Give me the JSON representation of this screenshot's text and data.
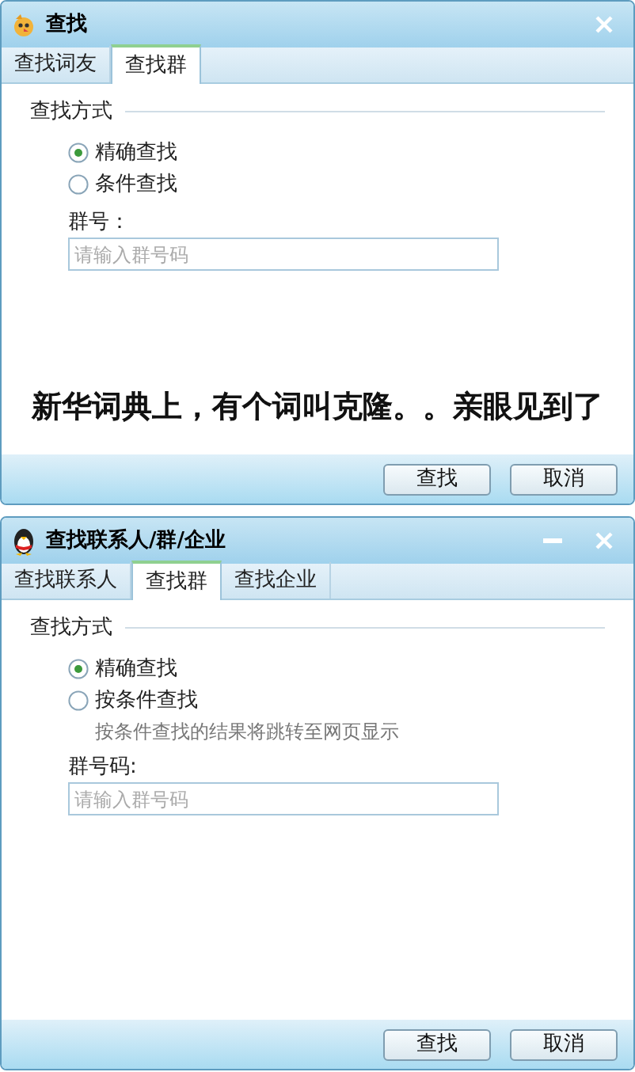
{
  "windows": [
    {
      "title": "查找",
      "kind": "classic",
      "tabs": [
        {
          "label": "查找词友",
          "selected": false
        },
        {
          "label": "查找群",
          "selected": true
        }
      ],
      "section": "查找方式",
      "options": [
        {
          "label": "精确查找",
          "selected": true
        },
        {
          "label": "条件查找",
          "selected": false
        }
      ],
      "field_label": "群号：",
      "placeholder": "请输入群号码",
      "caption": "新华词典上，有个词叫克隆。。亲眼见到了",
      "buttons": [
        "查找",
        "取消"
      ]
    },
    {
      "title": "查找联系人/群/企业",
      "kind": "modern",
      "tabs": [
        {
          "label": "查找联系人",
          "selected": false
        },
        {
          "label": "查找群",
          "selected": true
        },
        {
          "label": "查找企业",
          "selected": false
        }
      ],
      "section": "查找方式",
      "options": [
        {
          "label": "精确查找",
          "selected": true
        },
        {
          "label": "按条件查找",
          "selected": false,
          "hint": "按条件查找的结果将跳转至网页显示"
        }
      ],
      "field_label": "群号码:",
      "placeholder": "请输入群号码",
      "buttons": [
        "查找",
        "取消"
      ]
    }
  ]
}
